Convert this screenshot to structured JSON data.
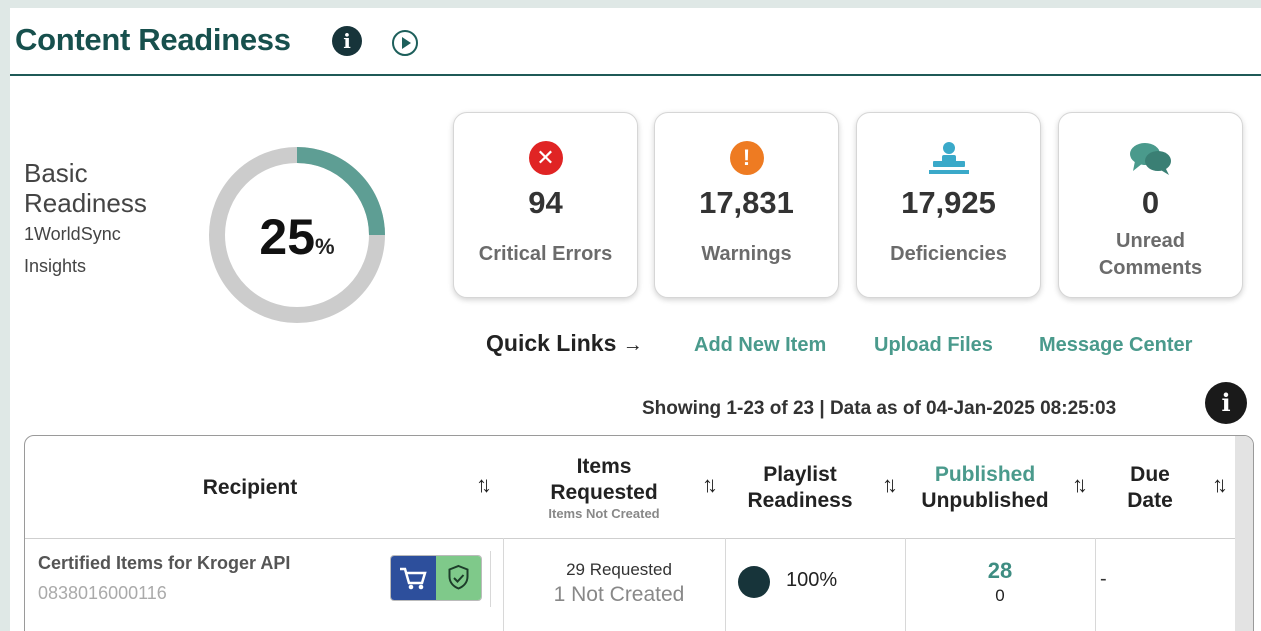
{
  "header": {
    "title": "Content Readiness"
  },
  "readiness": {
    "label_line1": "Basic",
    "label_line2": "Readiness",
    "source_line1": "1WorldSync",
    "source_line2": "Insights",
    "value": "25",
    "unit": "%",
    "progress_fraction": 0.25,
    "colors": {
      "filled": "#5e9e94",
      "track": "#cccccc"
    }
  },
  "cards": [
    {
      "value": "94",
      "label": "Critical Errors",
      "icon": "x-circle-icon",
      "color": "#e02424"
    },
    {
      "value": "17,831",
      "label": "Warnings",
      "icon": "exclamation-circle-icon",
      "color": "#ee7b22"
    },
    {
      "value": "17,925",
      "label": "Deficiencies",
      "icon": "worker-icon",
      "color": "#3aa9c9"
    },
    {
      "value": "0",
      "label_line1": "Unread",
      "label_line2": "Comments",
      "icon": "chat-bubbles-icon",
      "color": "#4a9a8c"
    }
  ],
  "quick_links": {
    "label": "Quick Links",
    "arrow": "→",
    "links": [
      "Add New Item",
      "Upload Files",
      "Message Center"
    ]
  },
  "status": {
    "showing": "Showing 1-23 of 23 | Data as of 04-Jan-2025 08:25:03"
  },
  "table": {
    "columns": {
      "recipient": "Recipient",
      "items_requested": "Items Requested",
      "items_not_created": "Items Not Created",
      "playlist_line1": "Playlist",
      "playlist_line2": "Readiness",
      "published": "Published",
      "unpublished": "Unpublished",
      "due_line1": "Due",
      "due_line2": "Date"
    },
    "rows": [
      {
        "recipient": "Certified Items for Kroger API",
        "recipient_id": "0838016000116",
        "requested": "29 Requested",
        "not_created": "1 Not Created",
        "playlist_readiness": "100%",
        "published": "28",
        "unpublished": "0",
        "due_date": "-"
      }
    ]
  }
}
